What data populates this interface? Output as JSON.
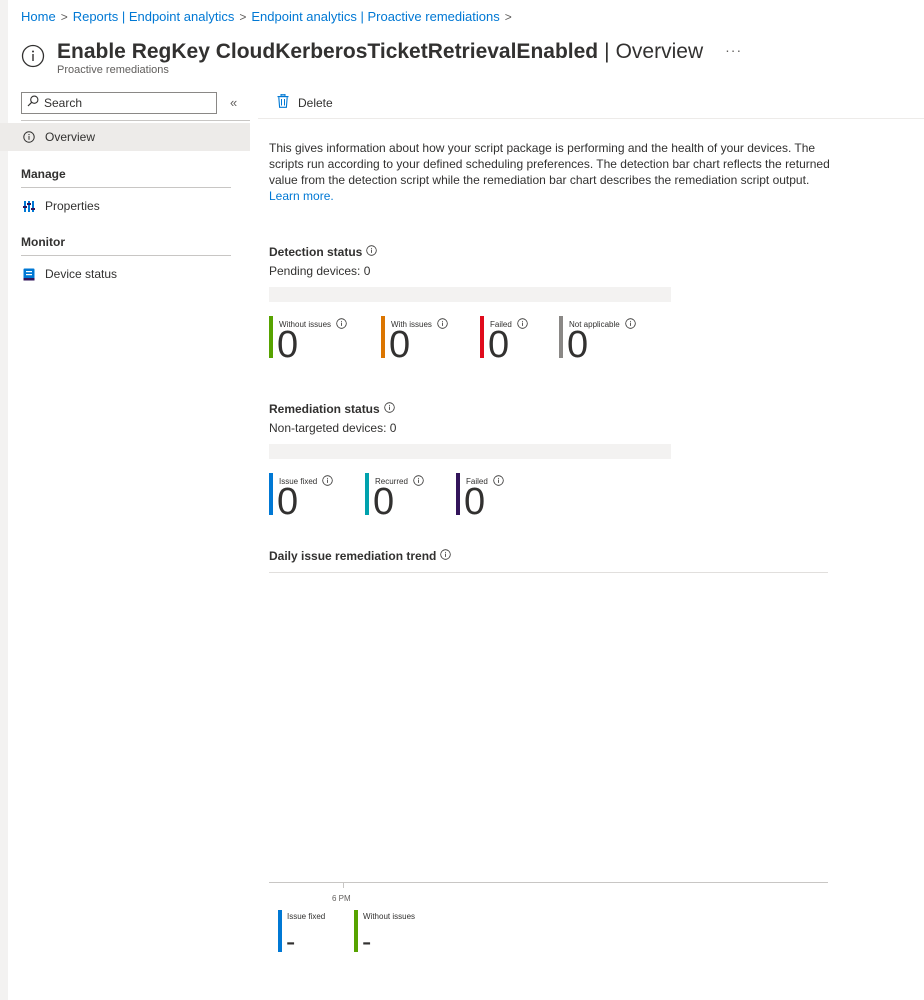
{
  "breadcrumb": [
    {
      "label": "Home"
    },
    {
      "label": "Reports | Endpoint analytics"
    },
    {
      "label": "Endpoint analytics | Proactive remediations"
    }
  ],
  "header": {
    "title": "Enable RegKey CloudKerberosTicketRetrievalEnabled",
    "separator": "|",
    "section": "Overview",
    "subtitle": "Proactive remediations",
    "more": "···"
  },
  "sidebar": {
    "search_placeholder": "Search",
    "collapse": "«",
    "overview_label": "Overview",
    "manage_header": "Manage",
    "properties_label": "Properties",
    "monitor_header": "Monitor",
    "device_status_label": "Device status"
  },
  "toolbar": {
    "delete_label": "Delete"
  },
  "description": {
    "text": "This gives information about how your script package is performing and the health of your devices. The scripts run according to your defined scheduling preferences. The detection bar chart reflects the returned value from the detection script while the remediation bar chart describes the remediation script output.",
    "link": "Learn more."
  },
  "detection": {
    "title": "Detection status",
    "subtitle": "Pending devices: 0",
    "stats": [
      {
        "label": "Without issues",
        "value": "0",
        "color": "#57a300"
      },
      {
        "label": "With issues",
        "value": "0",
        "color": "#db7500"
      },
      {
        "label": "Failed",
        "value": "0",
        "color": "#e00b1c"
      },
      {
        "label": "Not applicable",
        "value": "0",
        "color": "#8a8886"
      }
    ]
  },
  "remediation": {
    "title": "Remediation status",
    "subtitle": "Non-targeted devices: 0",
    "stats": [
      {
        "label": "Issue fixed",
        "value": "0",
        "color": "#0078d4"
      },
      {
        "label": "Recurred",
        "value": "0",
        "color": "#00a2ad"
      },
      {
        "label": "Failed",
        "value": "0",
        "color": "#32145a"
      }
    ]
  },
  "trend": {
    "title": "Daily issue remediation trend",
    "tick_label": "6 PM",
    "legend": [
      {
        "label": "Issue fixed",
        "value": "-",
        "color": "#0078d4"
      },
      {
        "label": "Without issues",
        "value": "-",
        "color": "#57a300"
      }
    ]
  },
  "colors": {
    "accent": "#0078d4"
  }
}
